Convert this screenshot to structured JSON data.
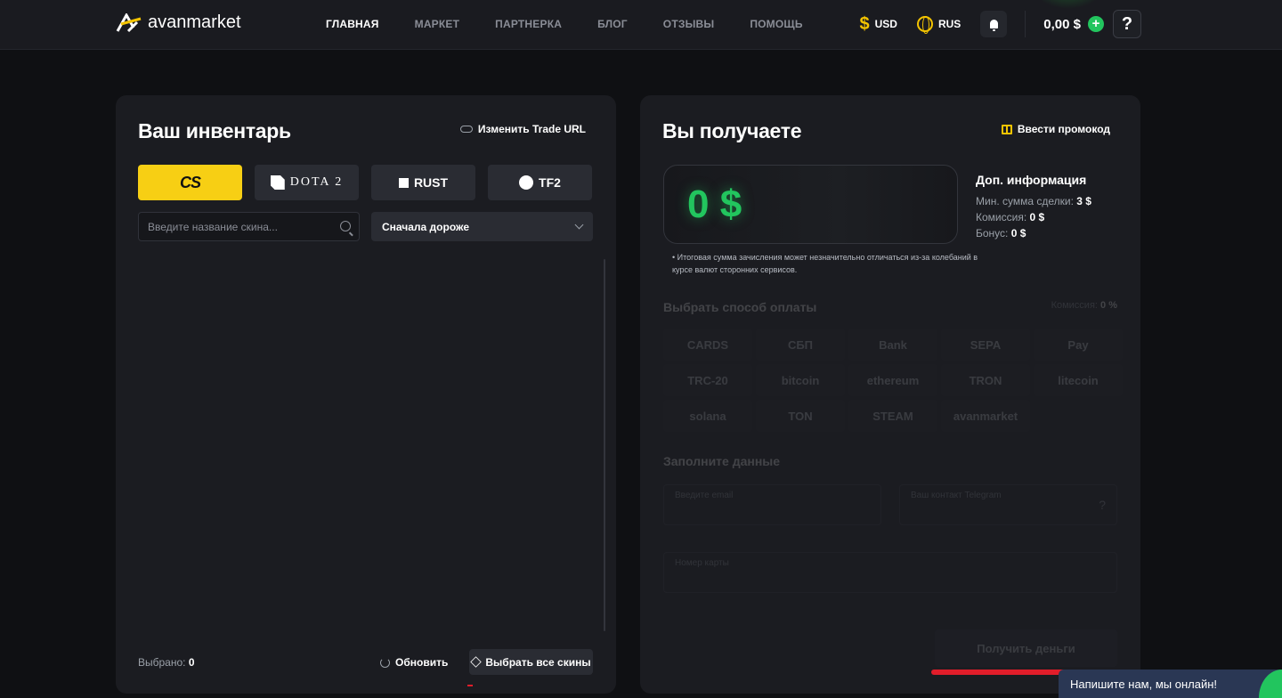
{
  "header": {
    "logo_a": "avan",
    "logo_b": "market",
    "nav": [
      "ГЛАВНАЯ",
      "МАРКЕТ",
      "ПАРТНЕРКА",
      "БЛОГ",
      "ОТЗЫВЫ",
      "ПОМОЩЬ"
    ],
    "currency_symbol": "$",
    "currency": "USD",
    "language": "RUS",
    "balance": "0,00 $",
    "plus": "+",
    "help": "?"
  },
  "inventory": {
    "title": "Ваш инвентарь",
    "trade_url_link": "Изменить Trade URL",
    "games": [
      "CS",
      "DOTA 2",
      "RUST",
      "TF2"
    ],
    "active_game": "CS",
    "search_placeholder": "Введите название скина...",
    "sort": "Сначала дороже",
    "selected_label": "Выбрано:",
    "selected_count": "0",
    "refresh": "Обновить",
    "select_all": "Выбрать все скины"
  },
  "receive": {
    "title": "Вы получаете",
    "promo_link": "Ввести промокод",
    "amount": "0 $",
    "info_title": "Доп. информация",
    "min_label": "Мин. сумма сделки:",
    "min_value": "3 $",
    "commission_label": "Комиссия:",
    "commission_value": "0 $",
    "bonus_label": "Бонус:",
    "bonus_value": "0 $",
    "note": "• Итоговая сумма зачисления может незначительно отличаться из-за колебаний в курсе валют сторонних сервисов.",
    "payment_title": "Выбрать способ оплаты",
    "payment_commission_label": "Комиссия:",
    "payment_commission_value": "0 %",
    "methods": [
      "CARDS",
      "СБП",
      "Bank",
      "SEPA",
      "Pay",
      "TRC-20",
      "bitcoin",
      "ethereum",
      "TRON",
      "litecoin",
      "solana",
      "TON",
      "STEAM",
      "avanmarket"
    ],
    "fill_title": "Заполните данные",
    "email_placeholder": "Введите email",
    "telegram_placeholder": "Ваш контакт Telegram",
    "card_placeholder": "Номер карты",
    "submit": "Получить деньги"
  },
  "chat": {
    "text": "Напишите нам, мы онлайн!"
  },
  "colors": {
    "accent_yellow": "#f7cf14",
    "accent_green": "#22c55e",
    "panel": "#1b1c21",
    "background": "#0f1013"
  }
}
